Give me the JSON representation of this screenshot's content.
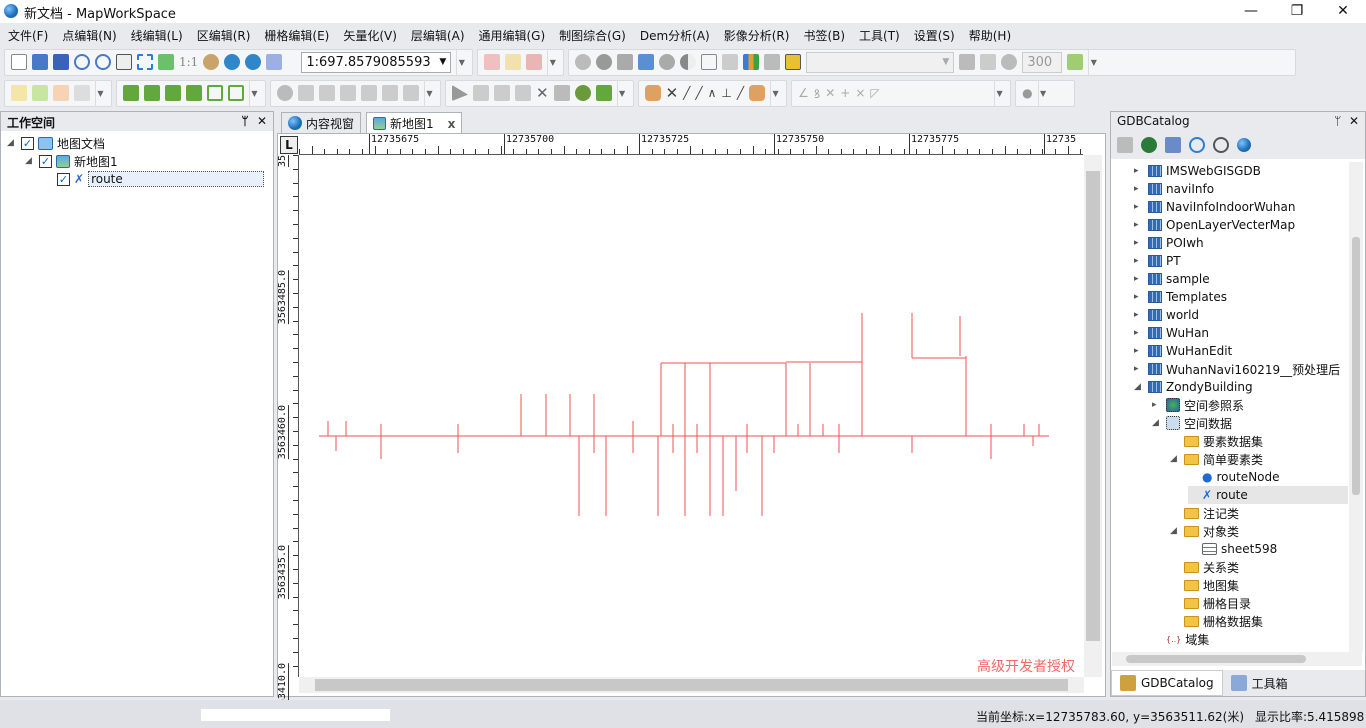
{
  "window": {
    "title": "新文档 - MapWorkSpace",
    "min": "—",
    "max": "❐",
    "close": "✕"
  },
  "menu": [
    "文件(F)",
    "点编辑(N)",
    "线编辑(L)",
    "区编辑(R)",
    "栅格编辑(E)",
    "矢量化(V)",
    "层编辑(A)",
    "通用编辑(G)",
    "制图综合(G)",
    "Dem分析(A)",
    "影像分析(R)",
    "书签(B)",
    "工具(T)",
    "设置(S)",
    "帮助(H)"
  ],
  "toolbar": {
    "scale_value": "1:697.8579085593",
    "one_to_one": "1:1",
    "dpi_value": "300",
    "layer_combo": ""
  },
  "workspace": {
    "title": "工作空间",
    "pin": "ᛘ",
    "close": "✕",
    "tree": [
      {
        "label": "地图文档",
        "level": 0
      },
      {
        "label": "新地图1",
        "level": 1
      },
      {
        "label": "route",
        "level": 2
      }
    ]
  },
  "tabs": [
    {
      "label": "内容视窗"
    },
    {
      "label": "新地图1",
      "close": "x"
    }
  ],
  "ruler": {
    "corner": "L",
    "x_labels": [
      "12735675",
      "12735700",
      "12735725",
      "12735750",
      "12735775",
      "12735"
    ],
    "y_labels": [
      "35",
      "3563485.0",
      "3563460.0",
      "3563435.0",
      "3563410.0"
    ]
  },
  "map": {
    "line_color": "#f05050",
    "watermark": "高级开发者授权"
  },
  "catalog": {
    "title": "GDBCatalog",
    "pin": "ᛘ",
    "close": "✕",
    "items": [
      {
        "label": "IMSWebGISGDB",
        "level": 0,
        "icon": "database-icon",
        "exp": "▸"
      },
      {
        "label": "naviInfo",
        "level": 0,
        "icon": "database-icon",
        "exp": "▸"
      },
      {
        "label": "NaviInfoIndoorWuhan",
        "level": 0,
        "icon": "database-icon",
        "exp": "▸"
      },
      {
        "label": "OpenLayerVecterMap",
        "level": 0,
        "icon": "database-icon",
        "exp": "▸"
      },
      {
        "label": "POIwh",
        "level": 0,
        "icon": "database-icon",
        "exp": "▸"
      },
      {
        "label": "PT",
        "level": 0,
        "icon": "database-icon",
        "exp": "▸"
      },
      {
        "label": "sample",
        "level": 0,
        "icon": "database-icon",
        "exp": "▸"
      },
      {
        "label": "Templates",
        "level": 0,
        "icon": "database-icon",
        "exp": "▸"
      },
      {
        "label": "world",
        "level": 0,
        "icon": "database-icon",
        "exp": "▸"
      },
      {
        "label": "WuHan",
        "level": 0,
        "icon": "database-icon",
        "exp": "▸"
      },
      {
        "label": "WuHanEdit",
        "level": 0,
        "icon": "database-icon",
        "exp": "▸"
      },
      {
        "label": "WuhanNavi160219__预处理后",
        "level": 0,
        "icon": "database-icon",
        "exp": "▸"
      },
      {
        "label": "ZondyBuilding",
        "level": 0,
        "icon": "database-icon",
        "exp": "◢"
      },
      {
        "label": "空间参照系",
        "level": 1,
        "icon": "spatial-reference-icon",
        "exp": "▸"
      },
      {
        "label": "空间数据",
        "level": 1,
        "icon": "spatial-data-icon",
        "exp": "◢"
      },
      {
        "label": "要素数据集",
        "level": 2,
        "icon": "folder-icon",
        "exp": ""
      },
      {
        "label": "简单要素类",
        "level": 2,
        "icon": "folder-icon",
        "exp": "◢"
      },
      {
        "label": "routeNode",
        "level": 3,
        "icon": "point-class-icon",
        "exp": ""
      },
      {
        "label": "route",
        "level": 3,
        "icon": "line-class-icon",
        "exp": "",
        "selected": true
      },
      {
        "label": "注记类",
        "level": 2,
        "icon": "folder-icon",
        "exp": ""
      },
      {
        "label": "对象类",
        "level": 2,
        "icon": "folder-icon",
        "exp": "◢"
      },
      {
        "label": "sheet598",
        "level": 3,
        "icon": "table-icon",
        "exp": ""
      },
      {
        "label": "关系类",
        "level": 2,
        "icon": "folder-icon",
        "exp": ""
      },
      {
        "label": "地图集",
        "level": 2,
        "icon": "folder-icon",
        "exp": ""
      },
      {
        "label": "栅格目录",
        "level": 2,
        "icon": "folder-icon",
        "exp": ""
      },
      {
        "label": "栅格数据集",
        "level": 2,
        "icon": "folder-icon",
        "exp": ""
      },
      {
        "label": "域集",
        "level": 1,
        "icon": "domain-icon",
        "exp": ""
      }
    ],
    "bottom_tabs": [
      {
        "label": "GDBCatalog"
      },
      {
        "label": "工具箱"
      }
    ]
  },
  "status": {
    "coords": "当前坐标:x=12735783.60, y=3563511.62(米)",
    "ratio": "显示比率:5.415898"
  }
}
